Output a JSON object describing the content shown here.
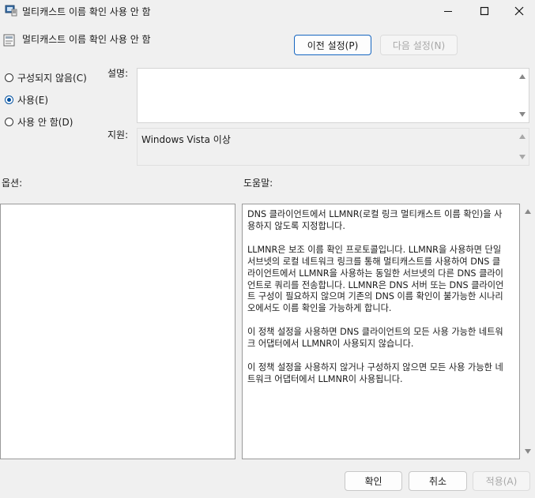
{
  "window": {
    "title": "멀티캐스트 이름 확인 사용 안 함",
    "minimize_icon": "minimize-icon",
    "maximize_icon": "maximize-icon",
    "close_icon": "close-icon"
  },
  "header": {
    "policy_name": "멀티캐스트 이름 확인 사용 안 함",
    "prev_button": "이전 설정(P)",
    "next_button": "다음 설정(N)"
  },
  "state": {
    "options": [
      {
        "label": "구성되지 않음(C)",
        "checked": false
      },
      {
        "label": "사용(E)",
        "checked": true
      },
      {
        "label": "사용 안 함(D)",
        "checked": false
      }
    ]
  },
  "comment": {
    "label": "설명:",
    "value": ""
  },
  "supported": {
    "label": "지원:",
    "value": "Windows Vista 이상"
  },
  "options_pane": {
    "label": "옵션:"
  },
  "help_pane": {
    "label": "도움말:",
    "paragraphs": [
      "DNS 클라이언트에서 LLMNR(로컬 링크 멀티캐스트 이름 확인)을 사용하지 않도록 지정합니다.",
      "LLMNR은 보조 이름 확인 프로토콜입니다. LLMNR을 사용하면 단일 서브넷의 로컬 네트워크 링크를 통해 멀티캐스트를 사용하여 DNS 클라이언트에서 LLMNR을 사용하는 동일한 서브넷의 다른 DNS 클라이언트로 쿼리를 전송합니다. LLMNR은 DNS 서버 또는 DNS 클라이언트 구성이 필요하지 않으며 기존의 DNS 이름 확인이 불가능한 시나리오에서도 이름 확인을 가능하게 합니다.",
      "이 정책 설정을 사용하면 DNS 클라이언트의 모든 사용 가능한 네트워크 어댑터에서 LLMNR이 사용되지 않습니다.",
      "이 정책 설정을 사용하지 않거나 구성하지 않으면 모든 사용 가능한 네트워크 어댑터에서 LLMNR이 사용됩니다."
    ]
  },
  "footer": {
    "ok_button": "확인",
    "cancel_button": "취소",
    "apply_button": "적용(A)"
  },
  "colors": {
    "accent": "#1565c0",
    "window_bg": "#f0f0f0",
    "disabled_text": "#a8a8a8"
  }
}
